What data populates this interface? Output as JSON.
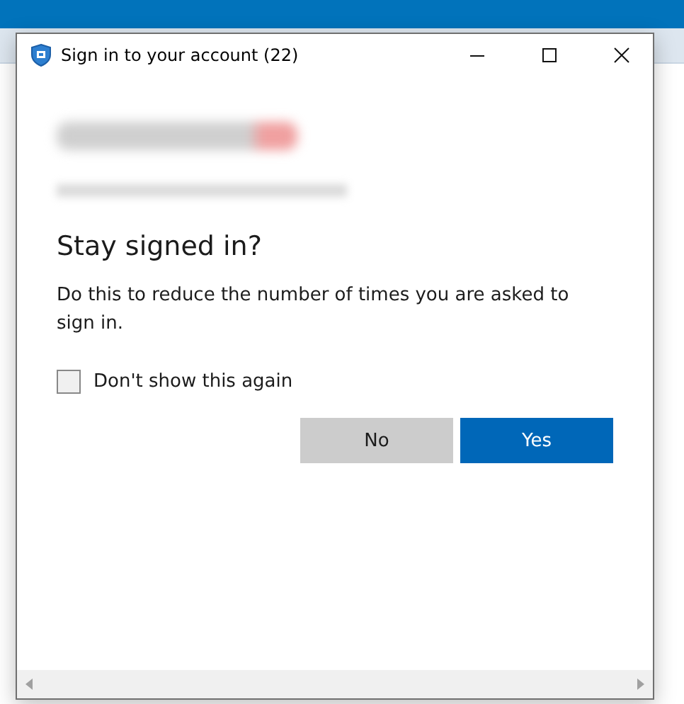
{
  "window": {
    "title": "Sign in to your account (22)"
  },
  "heading": "Stay signed in?",
  "description": "Do this to reduce the number of times you are asked to sign in.",
  "checkbox": {
    "label": "Don't show this again",
    "checked": false
  },
  "buttons": [
    {
      "label": "No",
      "kind": "secondary"
    },
    {
      "label": "Yes",
      "kind": "primary"
    }
  ]
}
